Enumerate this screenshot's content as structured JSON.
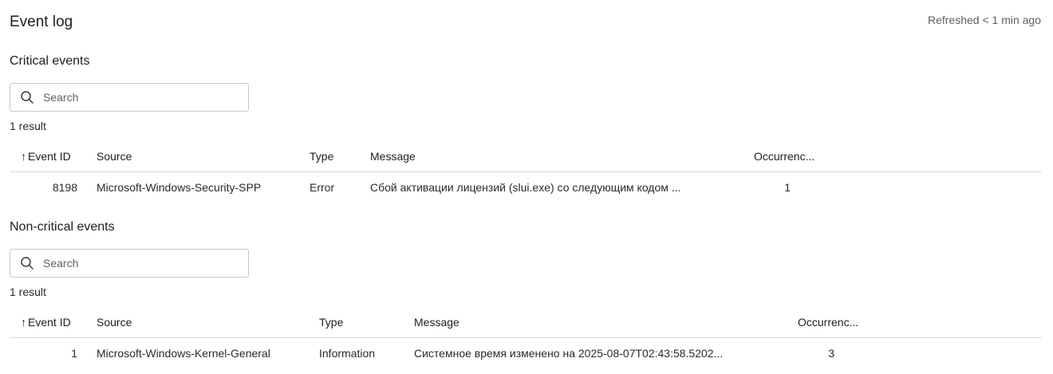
{
  "page": {
    "title": "Event log",
    "refreshed": "Refreshed < 1 min ago"
  },
  "critical": {
    "title": "Critical events",
    "search_placeholder": "Search",
    "result_count": "1 result",
    "columns": {
      "event_id": "Event ID",
      "source": "Source",
      "type": "Type",
      "message": "Message",
      "occurrences": "Occurrenc..."
    },
    "rows": [
      {
        "event_id": "8198",
        "source": "Microsoft-Windows-Security-SPP",
        "type": "Error",
        "message": "Сбой активации лицензий (slui.exe) со следующим кодом ...",
        "occurrences": "1"
      }
    ]
  },
  "noncritical": {
    "title": "Non-critical events",
    "search_placeholder": "Search",
    "result_count": "1 result",
    "columns": {
      "event_id": "Event ID",
      "source": "Source",
      "type": "Type",
      "message": "Message",
      "occurrences": "Occurrenc..."
    },
    "rows": [
      {
        "event_id": "1",
        "source": "Microsoft-Windows-Kernel-General",
        "type": "Information",
        "message": "Системное время изменено на 2025-08-07T02:43:58.5202...",
        "occurrences": "3"
      }
    ]
  },
  "icons": {
    "search": "search-icon",
    "sort": "arrow-up-icon"
  }
}
